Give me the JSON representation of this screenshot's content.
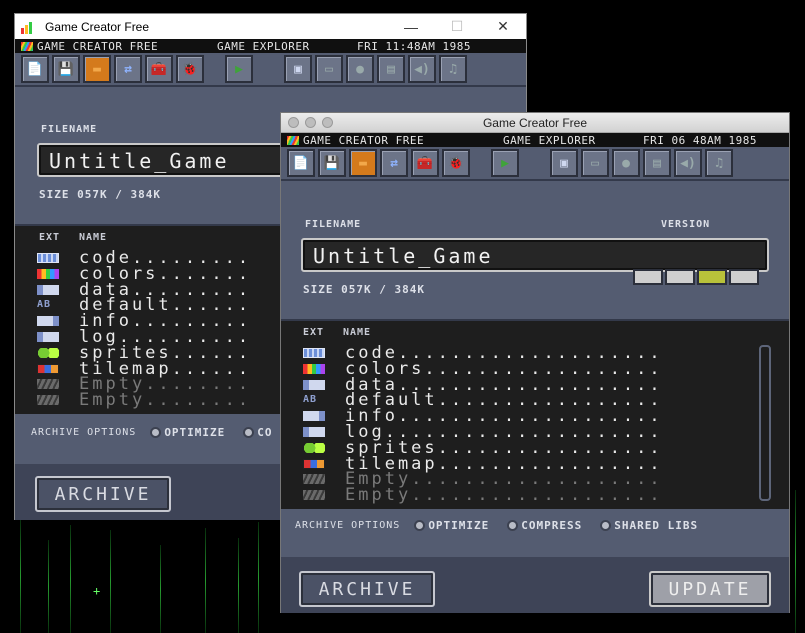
{
  "menubar": {
    "app_name": "GAME CREATOR FREE",
    "explorer": "GAME EXPLORER"
  },
  "window1": {
    "title": "Game Creator Free",
    "clock": "FRI 11:48AM 1985",
    "filename_label": "FILENAME",
    "filename_value": "Untitle_Game",
    "size_text": "SIZE 057K / 384K",
    "list_headers": {
      "ext": "EXT",
      "name": "NAME"
    },
    "files": [
      {
        "name": "code.........",
        "ext": "code"
      },
      {
        "name": "colors.......",
        "ext": "colors"
      },
      {
        "name": "data.........",
        "ext": "data"
      },
      {
        "name": "default......",
        "ext": "default"
      },
      {
        "name": "info.........",
        "ext": "info"
      },
      {
        "name": "log..........",
        "ext": "log"
      },
      {
        "name": "sprites......",
        "ext": "sprites"
      },
      {
        "name": "tilemap......",
        "ext": "tilemap"
      },
      {
        "name": "Empty........",
        "ext": "empty"
      },
      {
        "name": "Empty........",
        "ext": "empty"
      }
    ],
    "archive_options_label": "ARCHIVE OPTIONS",
    "options": [
      "OPTIMIZE",
      "CO"
    ],
    "archive_button": "ARCHIVE"
  },
  "window2": {
    "title": "Game Creator Free",
    "clock": "FRI 06 48AM 1985",
    "filename_label": "FILENAME",
    "version_label": "VERSION",
    "filename_value": "Untitle_Game",
    "size_text": "SIZE 057K / 384K",
    "list_headers": {
      "ext": "EXT",
      "name": "NAME"
    },
    "files": [
      {
        "name": "code....................",
        "ext": "code"
      },
      {
        "name": "colors..................",
        "ext": "colors"
      },
      {
        "name": "data....................",
        "ext": "data"
      },
      {
        "name": "default.................",
        "ext": "default"
      },
      {
        "name": "info....................",
        "ext": "info"
      },
      {
        "name": "log.....................",
        "ext": "log"
      },
      {
        "name": "sprites.................",
        "ext": "sprites"
      },
      {
        "name": "tilemap.................",
        "ext": "tilemap"
      },
      {
        "name": "Empty...................",
        "ext": "empty"
      },
      {
        "name": "Empty...................",
        "ext": "empty"
      }
    ],
    "archive_options_label": "ARCHIVE OPTIONS",
    "options": [
      "OPTIMIZE",
      "COMPRESS",
      "SHARED LIBS"
    ],
    "archive_button": "ARCHIVE",
    "update_button": "UPDATE"
  },
  "icons": {
    "new": "📄",
    "save": "💾",
    "open": "▬",
    "share": "⇄",
    "toolbox": "🧰",
    "debug": "🐞",
    "play": "▶",
    "apps": [
      "▣",
      "▭",
      "●",
      "▤",
      "◀)",
      "♫"
    ]
  },
  "ext_default_glyph": "AB",
  "colors": {
    "window_bg": "#545c71",
    "list_bg": "#1e1e1e",
    "accent_green": "#3fa33a"
  }
}
